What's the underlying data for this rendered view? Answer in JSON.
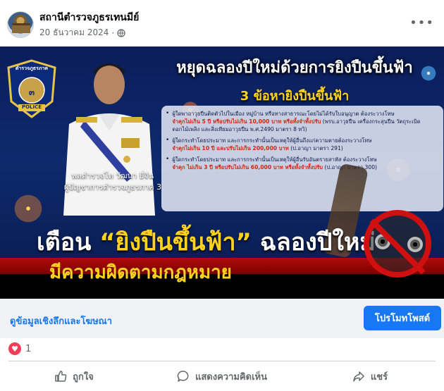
{
  "post": {
    "page_name": "สถานีตำรวจภูธรเทนมีย์",
    "date": "20 ธันวาคม 2024",
    "privacy_icon": "globe-icon",
    "more_icon": "more-options-icon",
    "more_label": "•••"
  },
  "banner": {
    "badge_top": "ตำรวจภูธรภาค",
    "badge_num": "๓",
    "badge_bottom": "POLICE",
    "title": "หยุดฉลองปีใหม่ด้วยการยิงปืนขึ้นฟ้า",
    "subtitle": "3 ข้อหายิงปืนขึ้นฟ้า",
    "officer_name": "พลตำรวจโท วัฒนา ยี่จีน",
    "officer_title": "ผู้บัญชาการตำรวจภูธรภาค 3",
    "rules": [
      {
        "text": "ผู้ใดพาอาวุธปืนติดตัวไปในเมือง หมู่บ้าน หรือทางสาธารณะโดยไม่ได้รับใบอนุญาต ต้องระวางโทษ",
        "penalty": "จำคุกไม่เกิน 5 ปี หรือปรับไม่เกิน 10,000 บาท หรือทั้งจำทั้งปรับ",
        "law": "(พรบ.อาวุธปืน เครื่องกระสุนปืน วัตถุระเบิด ดอกไม้เพลิง และสิ่งเทียมอาวุธปืน พ.ศ.2490 มาตรา 8 ทวิ)"
      },
      {
        "text": "ผู้ใดกระทำโดยประมาท และการกระทำนั้นเป็นเหตุให้ผู้อื่นถึงแก่ความตายต้องระวางโทษ",
        "penalty": "จำคุกไม่เกิน 10 ปี และปรับไม่เกิน 200,000 บาท",
        "law": "(ป.อาญา มาตรา 291)"
      },
      {
        "text": "ผู้ใดกระทำโดยประมาท และการกระทำนั้นเป็นเหตุให้ผู้อื่นรับอันตรายสาหัส ต้องระวางโทษ",
        "penalty": "จำคุก ไม่เกิน 3 ปี หรือปรับไม่เกิน 60,000 บาท หรือทั้งจำทั้งปรับ",
        "law": "(ป.อาญา มาตรา 300)"
      }
    ],
    "warn_prefix": "เตือน ",
    "warn_quote": "“ยิงปืนขึ้นฟ้า”",
    "warn_suffix": " ฉลองปีใหม่",
    "warn_line2": "มีความผิดตามกฎหมาย"
  },
  "insights": {
    "link_label": "ดูข้อมูลเชิงลึกและโฆษณา",
    "boost_label": "โปรโมทโพสต์"
  },
  "reactions": {
    "icon": "heart-icon",
    "count": "1"
  },
  "actions": {
    "like_label": "ถูกใจ",
    "comment_label": "แสดงความคิดเห็น",
    "share_label": "แชร์"
  },
  "colors": {
    "accent": "#1877f2",
    "banner_bg": "#0c1d5a",
    "warning_yellow": "#ffd21f",
    "penalty_red": "#d3250f"
  }
}
